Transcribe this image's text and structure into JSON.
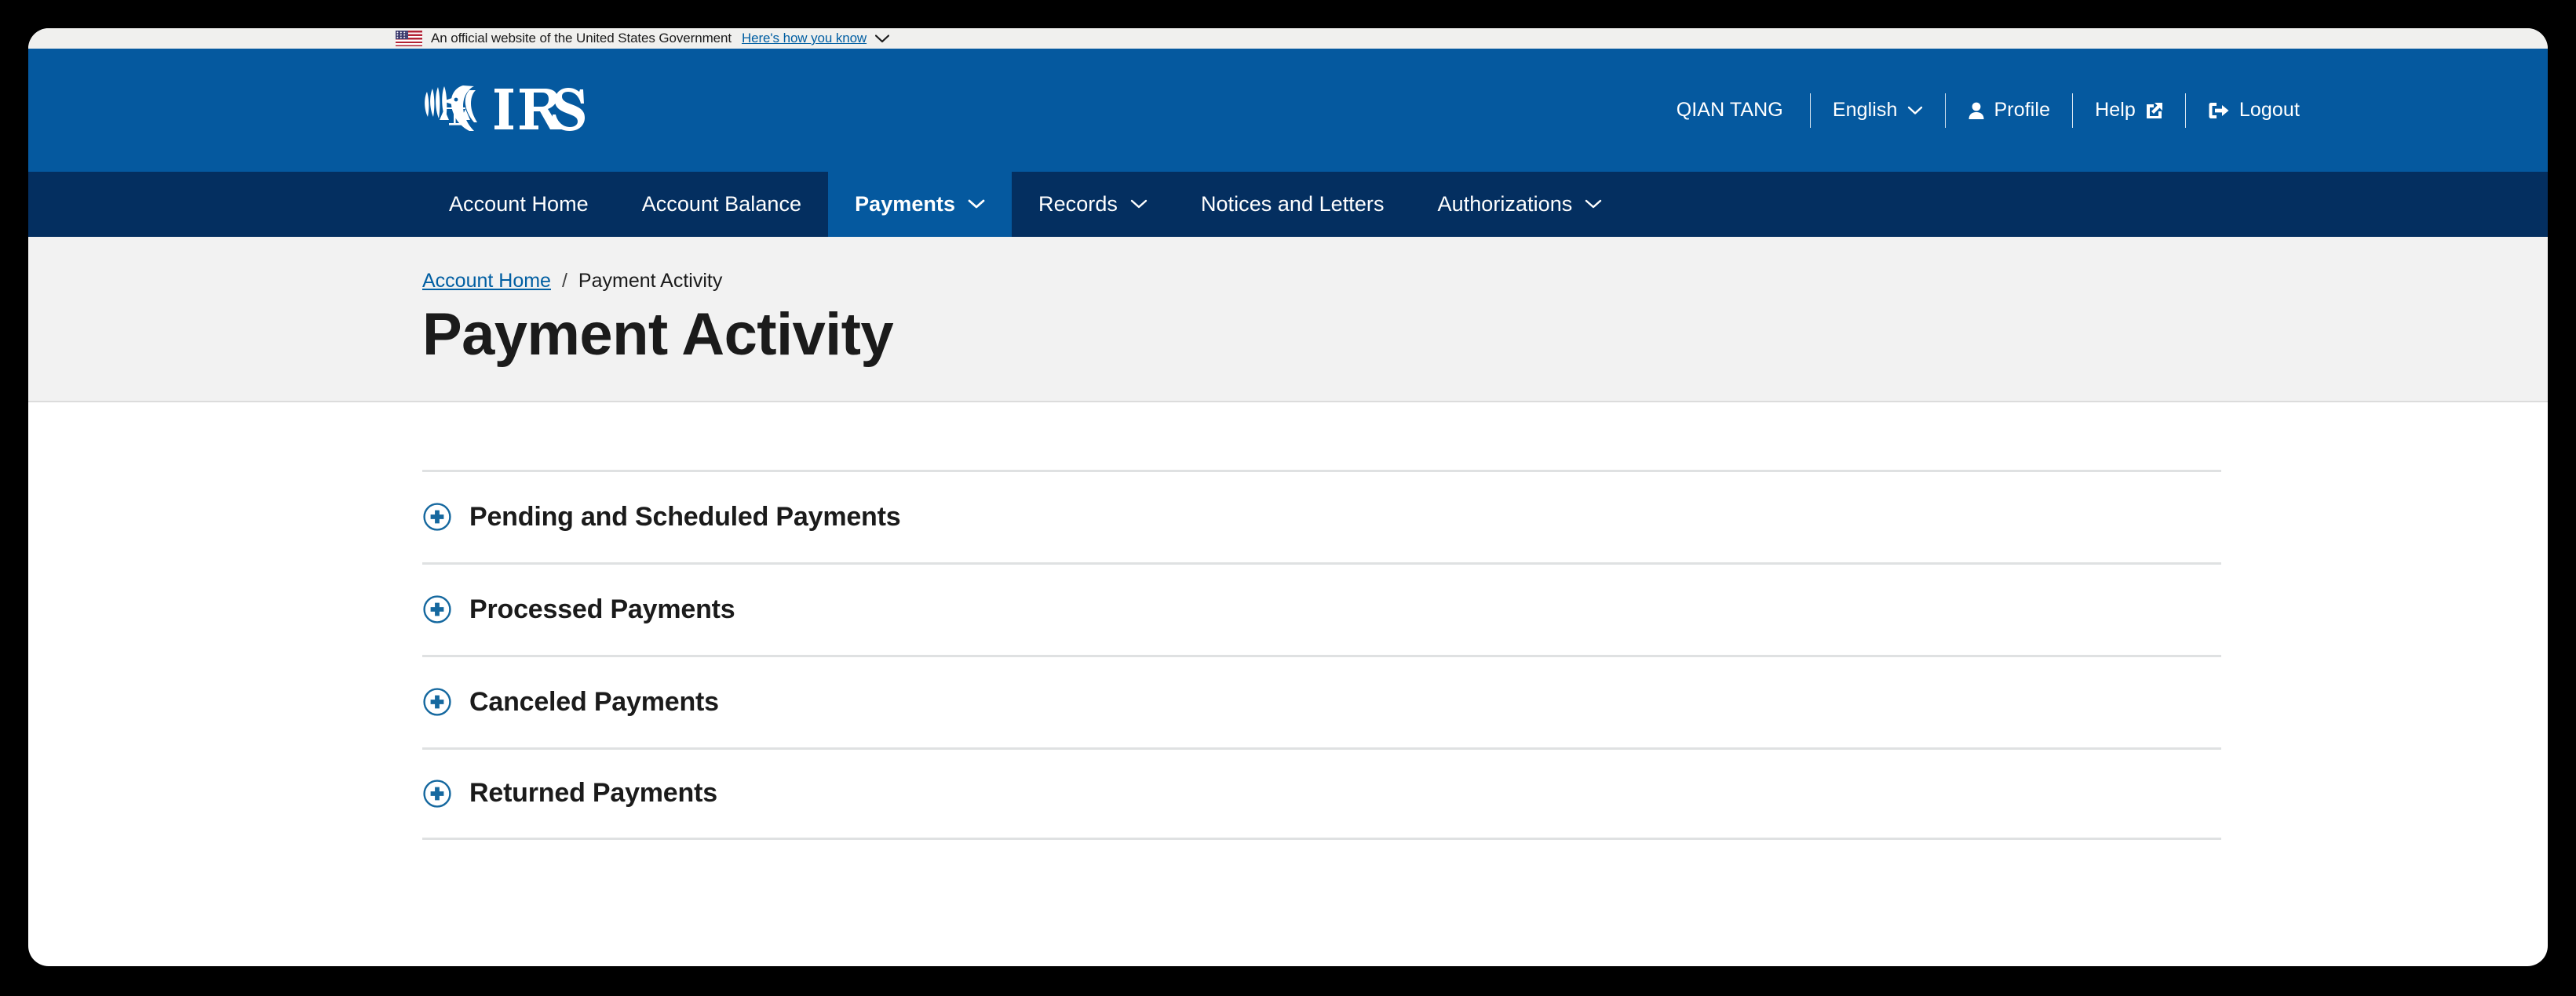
{
  "gov_banner": {
    "flag_icon": "us-flag-icon",
    "text": "An official website of the United States Government",
    "link_label": "Here's how you know",
    "chevron_icon": "chevron-down-icon"
  },
  "header": {
    "logo_alt": "IRS",
    "username": "QIAN TANG",
    "language": {
      "label": "English",
      "chevron_icon": "chevron-down-icon"
    },
    "profile": {
      "label": "Profile",
      "icon": "user-icon"
    },
    "help": {
      "label": "Help",
      "icon": "external-link-icon"
    },
    "logout": {
      "label": "Logout",
      "icon": "sign-out-icon"
    }
  },
  "nav": {
    "items": [
      {
        "label": "Account Home",
        "has_caret": false,
        "active": false
      },
      {
        "label": "Account Balance",
        "has_caret": false,
        "active": false
      },
      {
        "label": "Payments",
        "has_caret": true,
        "active": true
      },
      {
        "label": "Records",
        "has_caret": true,
        "active": false
      },
      {
        "label": "Notices and Letters",
        "has_caret": false,
        "active": false
      },
      {
        "label": "Authorizations",
        "has_caret": true,
        "active": false
      }
    ]
  },
  "hero": {
    "breadcrumb": {
      "home_label": "Account Home",
      "separator": "/",
      "current_label": "Payment Activity"
    },
    "title": "Payment Activity"
  },
  "accordion": {
    "items": [
      {
        "label": "Pending and Scheduled Payments",
        "expanded": false,
        "icon": "plus-circle-icon"
      },
      {
        "label": "Processed Payments",
        "expanded": false,
        "icon": "plus-circle-icon"
      },
      {
        "label": "Canceled Payments",
        "expanded": false,
        "icon": "plus-circle-icon"
      },
      {
        "label": "Returned Payments",
        "expanded": false,
        "icon": "plus-circle-icon"
      }
    ]
  },
  "colors": {
    "header_blue": "#05599f",
    "nav_navy": "#042f60",
    "link_blue": "#005ea2",
    "hero_gray": "#f2f2f2",
    "divider_gray": "#dfe1e2",
    "text_dark": "#1b1b1b",
    "page_black": "#000000"
  }
}
